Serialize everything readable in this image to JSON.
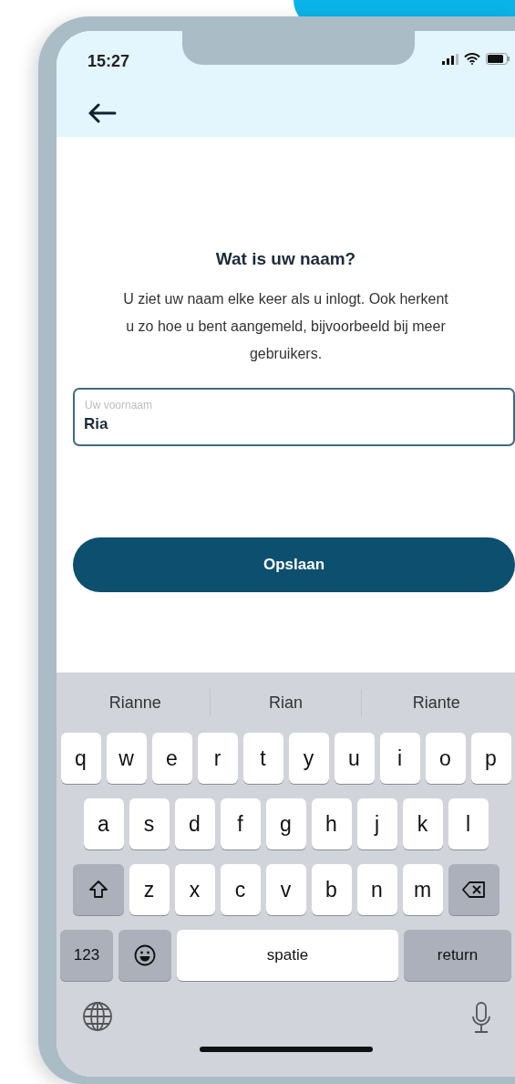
{
  "status_bar": {
    "time": "15:27"
  },
  "title": "Wat is uw naam?",
  "description": "U ziet uw naam elke keer als u inlogt. Ook herkent u zo hoe u bent aangemeld, bijvoorbeeld bij meer gebruikers.",
  "field": {
    "label": "Uw voornaam",
    "value": "Ria"
  },
  "button": "Opslaan",
  "keyboard": {
    "suggestions": [
      "Rianne",
      "Rian",
      "Riante"
    ],
    "rows": [
      [
        {
          "kind": "letter",
          "label": "q"
        },
        {
          "kind": "letter",
          "label": "w"
        },
        {
          "kind": "letter",
          "label": "e"
        },
        {
          "kind": "letter",
          "label": "r"
        },
        {
          "kind": "letter",
          "label": "t"
        },
        {
          "kind": "letter",
          "label": "y"
        },
        {
          "kind": "letter",
          "label": "u"
        },
        {
          "kind": "letter",
          "label": "i"
        },
        {
          "kind": "letter",
          "label": "o"
        },
        {
          "kind": "letter",
          "label": "p"
        }
      ],
      [
        {
          "kind": "letter",
          "label": "a"
        },
        {
          "kind": "letter",
          "label": "s"
        },
        {
          "kind": "letter",
          "label": "d"
        },
        {
          "kind": "letter",
          "label": "f"
        },
        {
          "kind": "letter",
          "label": "g"
        },
        {
          "kind": "letter",
          "label": "h"
        },
        {
          "kind": "letter",
          "label": "j"
        },
        {
          "kind": "letter",
          "label": "k"
        },
        {
          "kind": "letter",
          "label": "l"
        }
      ],
      [
        {
          "kind": "shift"
        },
        {
          "kind": "letter",
          "label": "z"
        },
        {
          "kind": "letter",
          "label": "x"
        },
        {
          "kind": "letter",
          "label": "c"
        },
        {
          "kind": "letter",
          "label": "v"
        },
        {
          "kind": "letter",
          "label": "b"
        },
        {
          "kind": "letter",
          "label": "n"
        },
        {
          "kind": "letter",
          "label": "m"
        },
        {
          "kind": "delete"
        }
      ]
    ],
    "bottom_row": [
      {
        "kind": "mode",
        "label": "123"
      },
      {
        "kind": "emoji"
      },
      {
        "kind": "space",
        "label": "spatie"
      },
      {
        "kind": "return",
        "label": "return"
      }
    ]
  }
}
